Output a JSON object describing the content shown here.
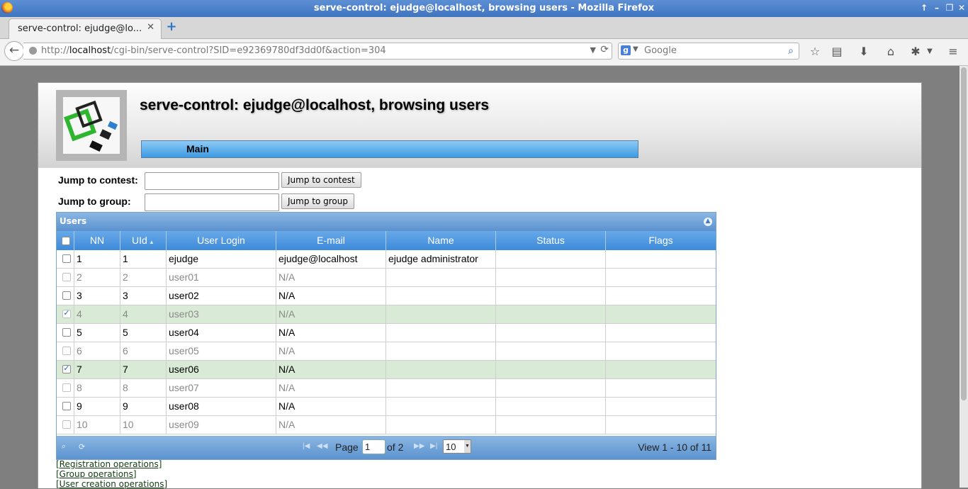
{
  "window": {
    "title": "serve-control: ejudge@localhost, browsing users - Mozilla Firefox"
  },
  "tab": {
    "label": "serve-control: ejudge@lo...",
    "close": "✕"
  },
  "nav": {
    "url_prefix": "http://",
    "url_host": "localhost",
    "url_path": "/cgi-bin/serve-control?SID=e92369780df3dd0f&action=304",
    "search_placeholder": "Google"
  },
  "page": {
    "title": "serve-control: ejudge@localhost, browsing users",
    "menu_main": "Main"
  },
  "jump": {
    "contest_label": "Jump to contest:",
    "contest_value": "",
    "contest_button": "Jump to contest",
    "group_label": "Jump to group:",
    "group_value": "",
    "group_button": "Jump to group"
  },
  "grid": {
    "caption": "Users",
    "columns": [
      "NN",
      "UId",
      "User Login",
      "E-mail",
      "Name",
      "Status",
      "Flags"
    ],
    "rows": [
      {
        "nn": "1",
        "uid": "1",
        "login": "ejudge",
        "email": "ejudge@localhost",
        "name": "ejudge administrator",
        "status": "",
        "flags": "",
        "checked": false,
        "disabled": false
      },
      {
        "nn": "2",
        "uid": "2",
        "login": "user01",
        "email": "N/A",
        "name": "",
        "status": "",
        "flags": "",
        "checked": false,
        "disabled": true
      },
      {
        "nn": "3",
        "uid": "3",
        "login": "user02",
        "email": "N/A",
        "name": "",
        "status": "",
        "flags": "",
        "checked": false,
        "disabled": false
      },
      {
        "nn": "4",
        "uid": "4",
        "login": "user03",
        "email": "N/A",
        "name": "",
        "status": "",
        "flags": "",
        "checked": true,
        "disabled": true
      },
      {
        "nn": "5",
        "uid": "5",
        "login": "user04",
        "email": "N/A",
        "name": "",
        "status": "",
        "flags": "",
        "checked": false,
        "disabled": false
      },
      {
        "nn": "6",
        "uid": "6",
        "login": "user05",
        "email": "N/A",
        "name": "",
        "status": "",
        "flags": "",
        "checked": false,
        "disabled": true
      },
      {
        "nn": "7",
        "uid": "7",
        "login": "user06",
        "email": "N/A",
        "name": "",
        "status": "",
        "flags": "",
        "checked": true,
        "disabled": false
      },
      {
        "nn": "8",
        "uid": "8",
        "login": "user07",
        "email": "N/A",
        "name": "",
        "status": "",
        "flags": "",
        "checked": false,
        "disabled": true
      },
      {
        "nn": "9",
        "uid": "9",
        "login": "user08",
        "email": "N/A",
        "name": "",
        "status": "",
        "flags": "",
        "checked": false,
        "disabled": false
      },
      {
        "nn": "10",
        "uid": "10",
        "login": "user09",
        "email": "N/A",
        "name": "",
        "status": "",
        "flags": "",
        "checked": false,
        "disabled": true
      }
    ],
    "pager": {
      "page_label": "Page",
      "page_value": "1",
      "of_label": "of 2",
      "rows_per_page": "10",
      "view_info": "View 1 - 10 of 11"
    }
  },
  "links": [
    "[Registration operations]",
    "[Group operations]",
    "[User creation operations]"
  ],
  "colors": {
    "accent": "#3d8ad9",
    "selected_row": "#d9ebd7",
    "menu_bar": "#3d9be3"
  }
}
